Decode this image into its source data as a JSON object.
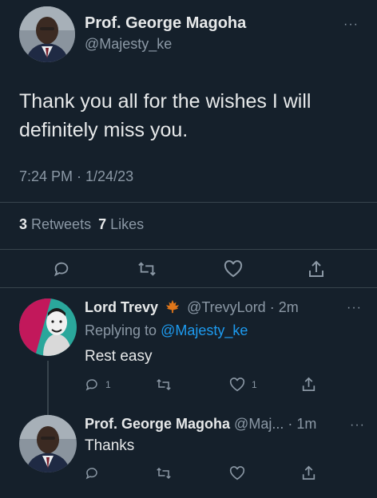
{
  "main_tweet": {
    "author_name": "Prof. George Magoha",
    "handle": "@Majesty_ke",
    "text_line1": "Thank you all for the wishes I will",
    "text_line2": "definitely miss you.",
    "timestamp": "7:24 PM · 1/24/23",
    "retweet_count": "3",
    "retweet_label": "Retweets",
    "like_count": "7",
    "like_label": "Likes",
    "more_label": "···"
  },
  "reply1": {
    "author_name": "Lord Trevy",
    "handle": "@TrevyLord",
    "time": "· 2m",
    "replying_prefix": "Replying to",
    "replying_handle": "@Majesty_ke",
    "text": "Rest easy",
    "reply_count": "1",
    "like_count": "1",
    "more_label": "···"
  },
  "reply2": {
    "author_name": "Prof. George Magoha",
    "handle": "@Maj...",
    "time": "· 1m",
    "text": "Thanks",
    "more_label": "···"
  },
  "colors": {
    "background": "#15202b",
    "text": "#e7e9ea",
    "muted": "#8b98a5",
    "link": "#1d9bf0",
    "divider": "#38444d"
  },
  "icons": [
    "reply-icon",
    "retweet-icon",
    "like-icon",
    "share-icon",
    "maple-leaf-icon",
    "more-icon"
  ]
}
